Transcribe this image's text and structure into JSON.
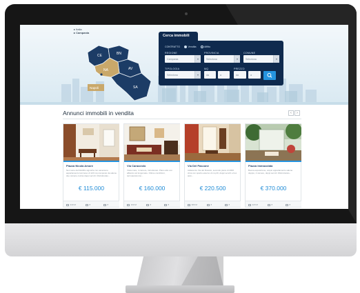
{
  "breadcrumb": {
    "level1": "Italia",
    "level2": "Campania"
  },
  "map": {
    "provinces": [
      "CE",
      "BN",
      "AV",
      "NA",
      "SA"
    ],
    "selected_label": "Napoli",
    "colors": {
      "region": "#1c3c66",
      "selected": "#c9a86a"
    }
  },
  "search": {
    "title": "Cerca immobili",
    "contract_label": "CONTRATTO",
    "contract_options": [
      {
        "label": "Vendita",
        "selected": true
      },
      {
        "label": "Affitto",
        "selected": false
      }
    ],
    "fields": {
      "regione": {
        "label": "REGIONE",
        "value": "Campania"
      },
      "provincia": {
        "label": "PROVINCIA",
        "value": "Seleziona"
      },
      "comune": {
        "label": "COMUNE",
        "value": "Seleziona"
      },
      "tipologia": {
        "label": "TIPOLOGIA",
        "value": "Seleziona"
      },
      "mq": {
        "label": "MQ",
        "from": "da",
        "to": "a"
      },
      "prezzo": {
        "label": "PREZZO",
        "from": "da",
        "to": "a"
      }
    },
    "submit_icon": "search-icon"
  },
  "listings_section": {
    "title": "Annunci immobili in vendita",
    "prev": "‹",
    "next": "›"
  },
  "listings": [
    {
      "title": "Piazza Nicola Amore",
      "description": "Nel cuore del Rettifilo signorile con ascensore appartamento luminoso di 120 mq composto da salone due camere cucina doppi servizi. Ristrutturato...",
      "price": "€ 115.000",
      "area": "340 M",
      "rooms": "8",
      "baths": "8",
      "photo_icon": "apartment-interior-photo"
    },
    {
      "title": "Via Caracciolo",
      "description": "Vista mare, 4 camere, ristrutturato. Piano alto con affaccio sul lungomare. Ottime condizioni, termoautonomo...",
      "price": "€ 160.000",
      "area": "160 M",
      "rooms": "8",
      "baths": "8",
      "photo_icon": "living-room-photo"
    },
    {
      "title": "Via Del Pascone",
      "description": "Adiacenze Via del Rosario, secondo piano di 2000 circa con spazio esterno di mq 20, doppi servizi e box auto...",
      "price": "€ 220.500",
      "area": "380 M",
      "rooms": "8",
      "baths": "8",
      "photo_icon": "hallway-photo"
    },
    {
      "title": "Piazza Immacolata",
      "description": "Buona esposizione, ampio appartamento salone doppio, 2 camere, doppi servizi. Ristrutturato...",
      "price": "€ 370.000",
      "area": "220 M",
      "rooms": "8",
      "baths": "8",
      "photo_icon": "terrace-photo"
    }
  ],
  "colors": {
    "accent": "#2594e0",
    "navy": "#0f2a4e",
    "price": "#1f8bd6"
  }
}
